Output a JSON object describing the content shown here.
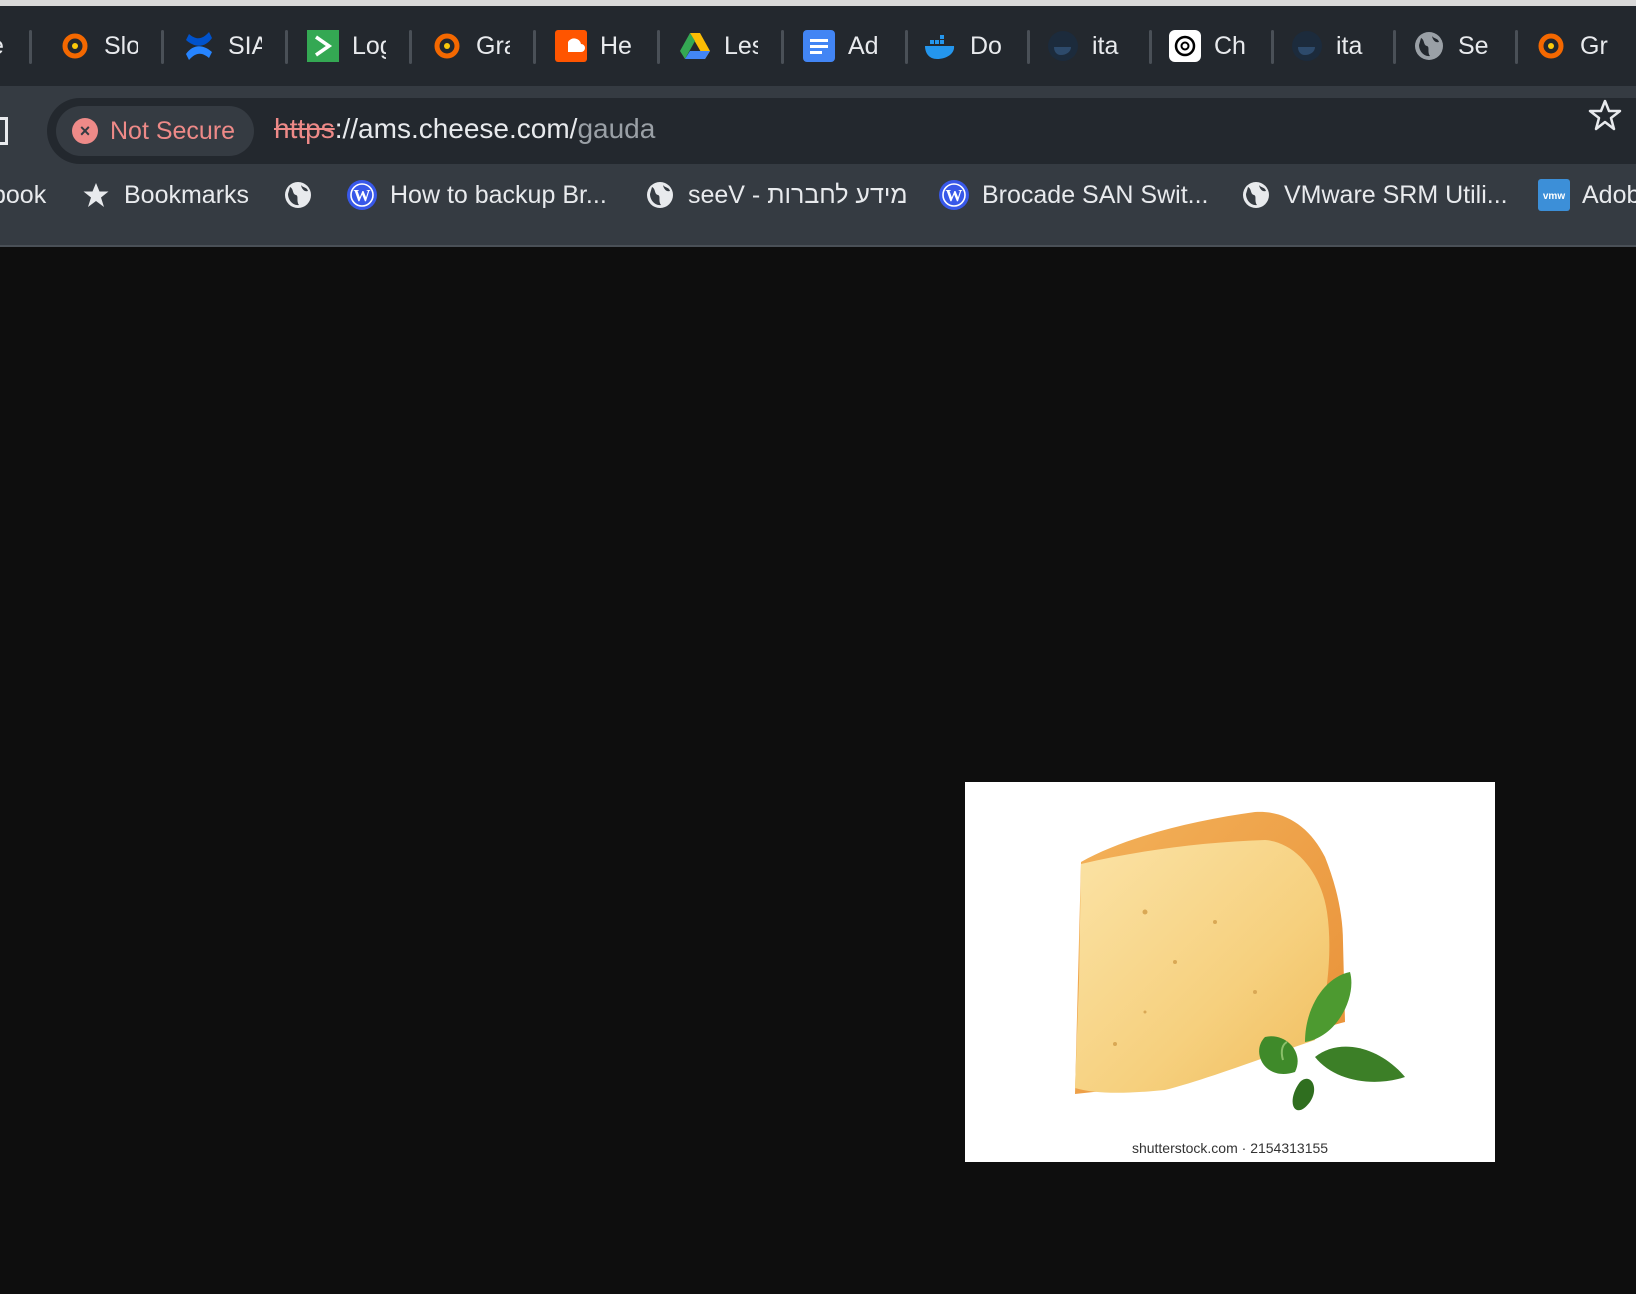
{
  "tabs": [
    {
      "title": "Re",
      "icon": "grafana-icon"
    },
    {
      "title": "Slo",
      "icon": "grafana-icon"
    },
    {
      "title": "SIA",
      "icon": "confluence-icon"
    },
    {
      "title": "Log",
      "icon": "terminal-icon"
    },
    {
      "title": "Gra",
      "icon": "grafana-icon"
    },
    {
      "title": "He",
      "icon": "soundcloud-icon"
    },
    {
      "title": "Les",
      "icon": "google-drive-icon"
    },
    {
      "title": "Ad",
      "icon": "google-docs-icon"
    },
    {
      "title": "Do",
      "icon": "docker-icon"
    },
    {
      "title": "ita",
      "icon": "docker-dark-icon"
    },
    {
      "title": "Ch",
      "icon": "openai-icon"
    },
    {
      "title": "ita",
      "icon": "docker-dark-icon"
    },
    {
      "title": "Se",
      "icon": "globe-icon"
    },
    {
      "title": "Gr",
      "icon": "grafana-icon"
    }
  ],
  "omnibox": {
    "security_label": "Not Secure",
    "url_scheme": "https",
    "url_host": "://ams.cheese.com/",
    "url_path": "gauda"
  },
  "bookmarks": [
    {
      "label": "book",
      "icon": ""
    },
    {
      "label": "Bookmarks",
      "icon": "star-icon"
    },
    {
      "label": "",
      "icon": "globe-icon"
    },
    {
      "label": "How to backup Br...",
      "icon": "wordpress-icon"
    },
    {
      "label": "seeV - מידע לחברות",
      "icon": "globe-icon"
    },
    {
      "label": "Brocade SAN Swit...",
      "icon": "wordpress-icon"
    },
    {
      "label": "VMware SRM Utili...",
      "icon": "globe-icon"
    },
    {
      "label": "Adob",
      "icon": "vmware-icon"
    }
  ],
  "page": {
    "image_credit": "shutterstock.com · 2154313155"
  },
  "colors": {
    "tabstrip": "#23282e",
    "toolbar": "#353b42",
    "not_secure": "#ee8a88",
    "page_bg": "#0e0e0e"
  }
}
